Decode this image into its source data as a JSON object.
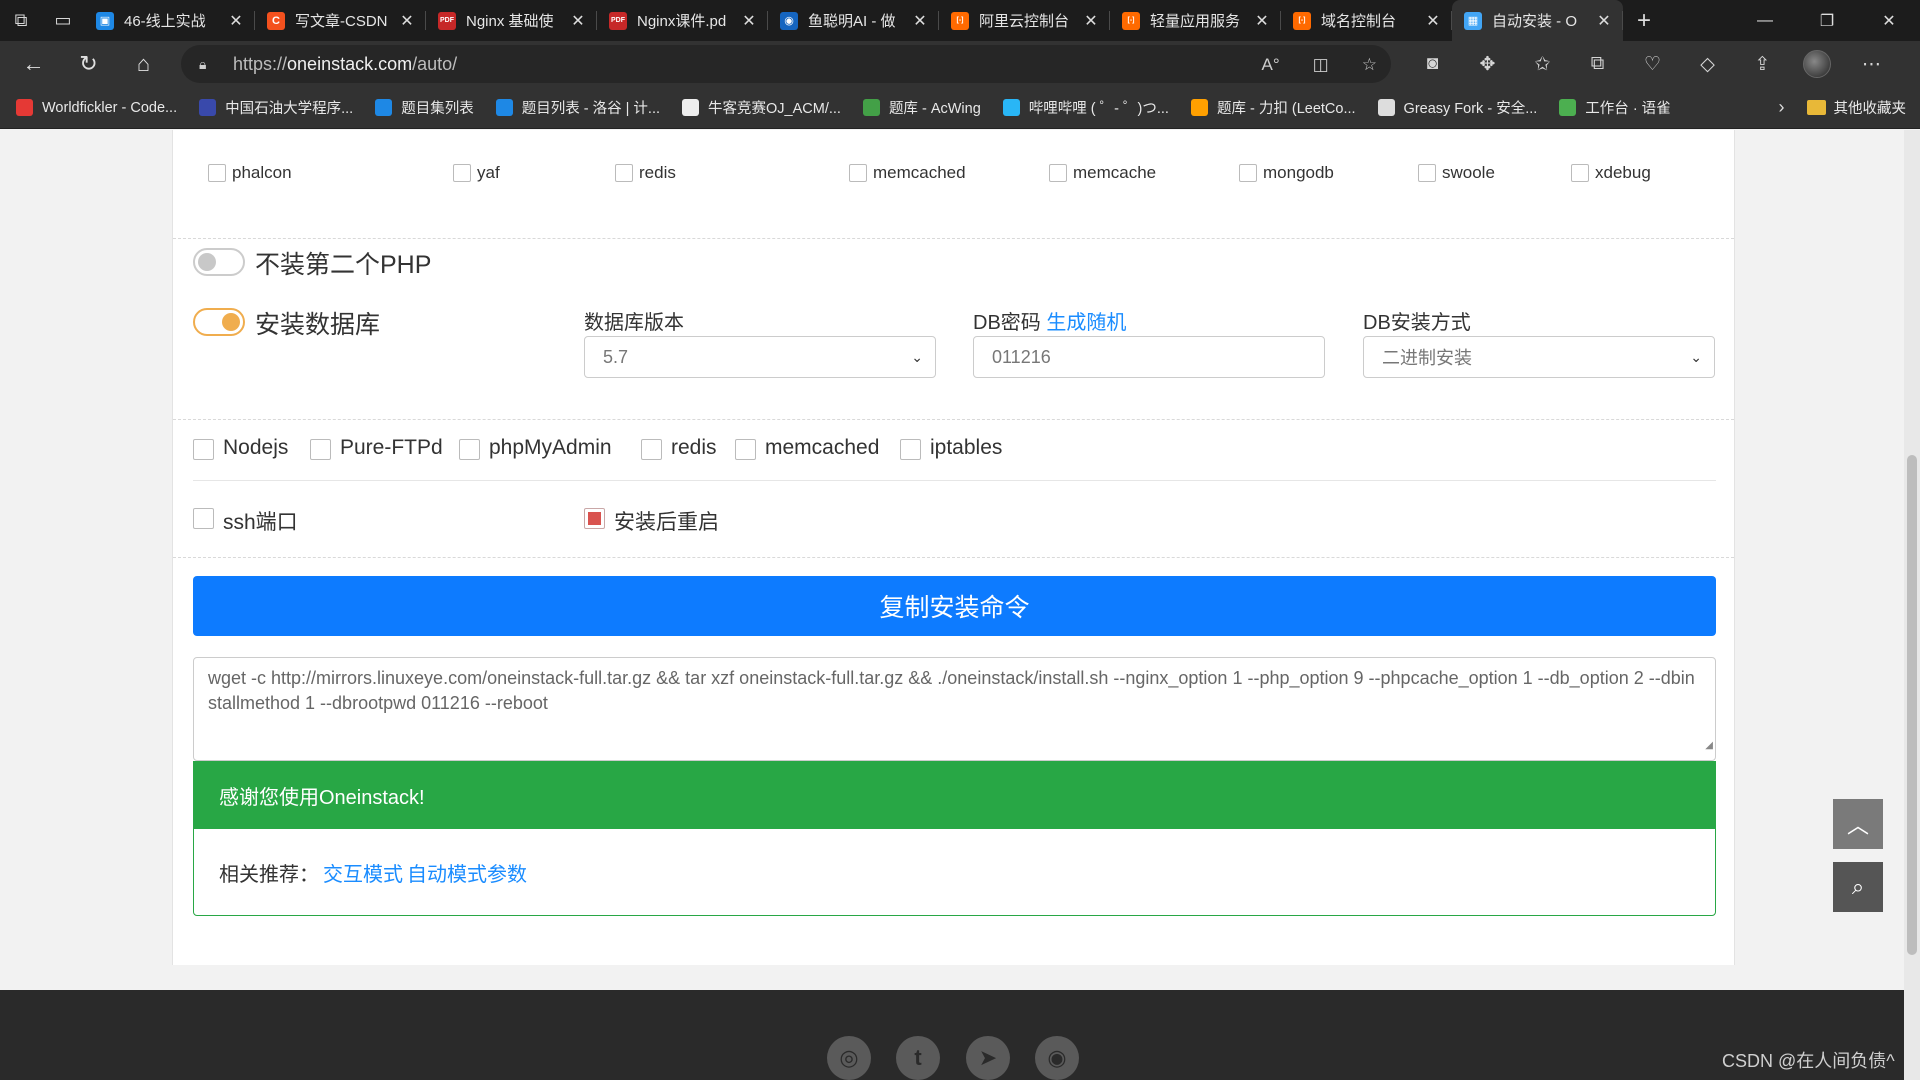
{
  "browser": {
    "tabs": [
      {
        "title": "46-线上实战",
        "fav_color": "#1e88e5",
        "fav_glyph": "▣"
      },
      {
        "title": "写文章-CSDN",
        "fav_color": "#f4511e",
        "fav_glyph": "C"
      },
      {
        "title": "Nginx 基础使",
        "fav_color": "#c62828",
        "fav_glyph": "PDF"
      },
      {
        "title": "Nginx课件.pd",
        "fav_color": "#c62828",
        "fav_glyph": "PDF"
      },
      {
        "title": "鱼聪明AI - 做",
        "fav_color": "#1565c0",
        "fav_glyph": "◉"
      },
      {
        "title": "阿里云控制台",
        "fav_color": "#ff6a00",
        "fav_glyph": "[-]"
      },
      {
        "title": "轻量应用服务",
        "fav_color": "#ff6a00",
        "fav_glyph": "[-]"
      },
      {
        "title": "域名控制台",
        "fav_color": "#ff6a00",
        "fav_glyph": "[-]"
      },
      {
        "title": "自动安装 - O",
        "fav_color": "#42a5f5",
        "fav_glyph": "▦"
      }
    ],
    "new_tab_symbol": "+",
    "url_prefix": "https://",
    "url_host": "oneinstack.com",
    "url_path": "/auto/",
    "bookmarks": [
      {
        "label": "Worldfickler - Code...",
        "color": "#e53935"
      },
      {
        "label": "中国石油大学程序...",
        "color": "#3949ab"
      },
      {
        "label": "题目集列表",
        "color": "#1e88e5"
      },
      {
        "label": "题目列表 - 洛谷 | 计...",
        "color": "#1e88e5"
      },
      {
        "label": "牛客竞赛OJ_ACM/...",
        "color": "#eeeeee"
      },
      {
        "label": "题库 - AcWing",
        "color": "#43a047"
      },
      {
        "label": "哔哩哔哩 ( ゜- ゜)つ...",
        "color": "#29b6f6"
      },
      {
        "label": "题库 - 力扣 (LeetCo...",
        "color": "#ffa000"
      },
      {
        "label": "Greasy Fork - 安全...",
        "color": "#dddddd"
      },
      {
        "label": "工作台 · 语雀",
        "color": "#4caf50"
      }
    ],
    "other_bookmarks": "其他收藏夹"
  },
  "php_ext_row": [
    {
      "label": "phalcon",
      "checked": false
    },
    {
      "label": "yaf",
      "checked": false
    },
    {
      "label": "redis",
      "checked": false
    },
    {
      "label": "memcached",
      "checked": false
    },
    {
      "label": "memcache",
      "checked": false
    },
    {
      "label": "mongodb",
      "checked": false
    },
    {
      "label": "swoole",
      "checked": false
    },
    {
      "label": "xdebug",
      "checked": false
    }
  ],
  "second_php": {
    "label": "不装第二个PHP",
    "on": false
  },
  "database": {
    "label": "安装数据库",
    "on": true,
    "version_label": "数据库版本",
    "version_value": "5.7",
    "password_label": "DB密码",
    "password_link": "生成随机",
    "password_value": "011216",
    "method_label": "DB安装方式",
    "method_value": "二进制安装"
  },
  "components": [
    {
      "label": "Nodejs",
      "checked": false
    },
    {
      "label": "Pure-FTPd",
      "checked": false
    },
    {
      "label": "phpMyAdmin",
      "checked": false
    },
    {
      "label": "redis",
      "checked": false
    },
    {
      "label": "memcached",
      "checked": false
    },
    {
      "label": "iptables",
      "checked": false
    }
  ],
  "ssh_port": {
    "label": "ssh端口",
    "checked": false
  },
  "reboot": {
    "label": "安装后重启",
    "checked": true
  },
  "copy_button": "复制安装命令",
  "command": "wget -c http://mirrors.linuxeye.com/oneinstack-full.tar.gz && tar xzf oneinstack-full.tar.gz && ./oneinstack/install.sh --nginx_option 1 --php_option 9 --phpcache_option 1 --db_option 2 --dbinstallmethod 1 --dbrootpwd 011216 --reboot",
  "thanks": "感谢您使用Oneinstack!",
  "related_label": "相关推荐：",
  "related_link_1": "交互模式",
  "related_link_2": "自动模式参数",
  "watermark": "CSDN @在人间负债^"
}
